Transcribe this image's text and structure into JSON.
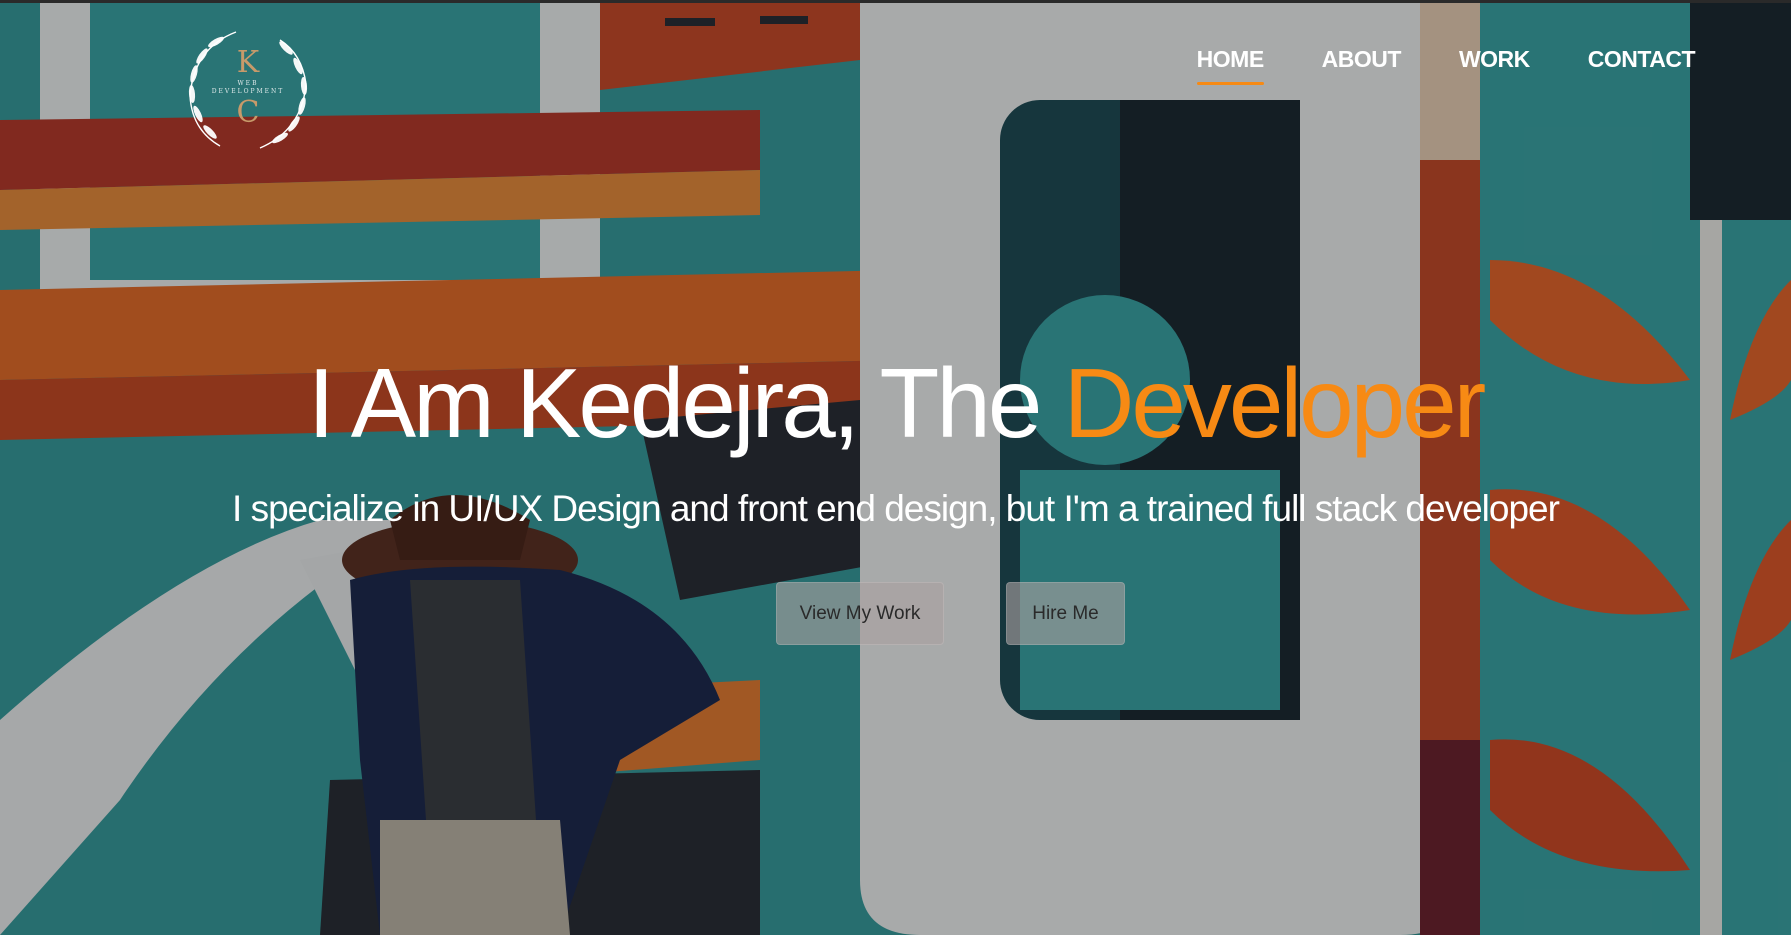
{
  "logo": {
    "top_letter": "K",
    "sub_line_1": "WEB",
    "sub_line_2": "DEVELOPMENT",
    "bottom_letter": "C",
    "color": "#c79a6a"
  },
  "nav": {
    "items": [
      {
        "label": "HOME",
        "active": true
      },
      {
        "label": "ABOUT",
        "active": false
      },
      {
        "label": "WORK",
        "active": false
      },
      {
        "label": "CONTACT",
        "active": false
      }
    ]
  },
  "hero": {
    "title_main": "I Am Kedejra, The ",
    "title_accent": "Developer",
    "subtitle": "I specialize in UI/UX Design and front end design, but I'm a trained full stack developer",
    "buttons": {
      "view_work": "View My Work",
      "hire_me": "Hire Me"
    }
  },
  "colors": {
    "accent": "#f78a14",
    "text": "#ffffff",
    "button_bg": "#aaa0a0"
  },
  "icons": {
    "logo_wreath": "laurel-wreath-icon"
  }
}
